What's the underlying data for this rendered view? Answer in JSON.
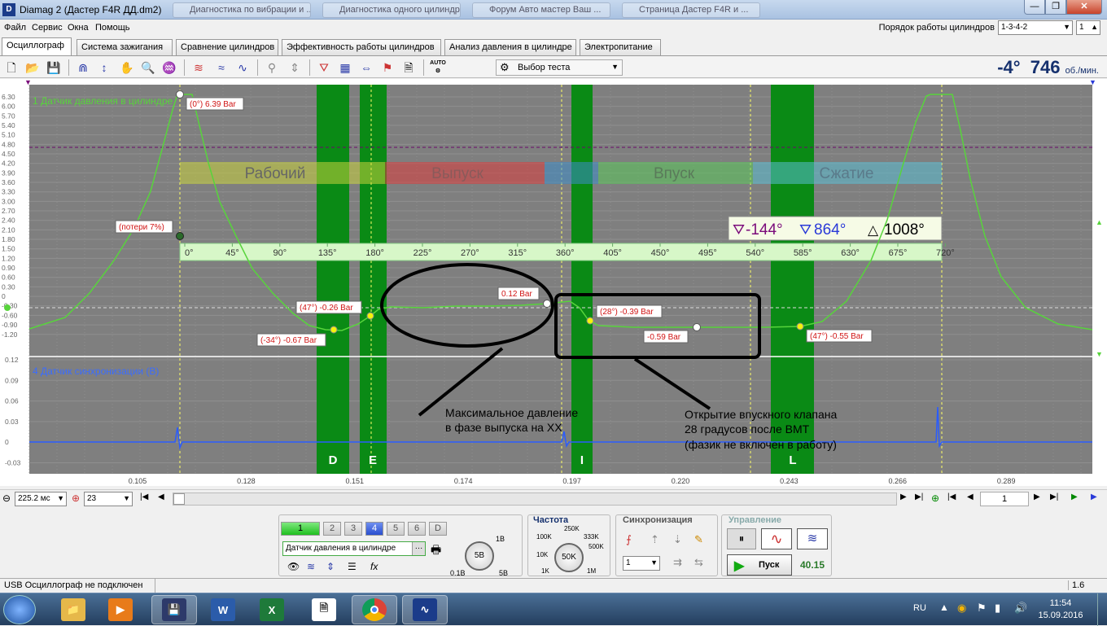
{
  "window": {
    "title": "Diamag 2 (Дастер F4R ДД.dm2)",
    "icon_label": "D",
    "bg_tabs": [
      "Диагностика по вибрации и ...",
      "Диагностика одного цилиндра",
      "Форум Авто мастер Ваш ...",
      "Страница Дастер F4R и ..."
    ]
  },
  "menu": {
    "items": [
      "Файл",
      "Сервис",
      "Окна",
      "Помощь"
    ]
  },
  "cyl_order": {
    "label": "Порядок работы цилиндров",
    "value": "1-3-4-2",
    "num": "1"
  },
  "tabs": [
    "Осциллограф",
    "Система зажигания",
    "Сравнение цилиндров",
    "Эффективность работы цилиндров",
    "Анализ давления в цилиндре",
    "Электропитание"
  ],
  "toolbar": {
    "test_select": "Выбор теста",
    "auto_label": "AUTO"
  },
  "rpm": {
    "angle": "-4°",
    "value": "746",
    "unit": "об./мин."
  },
  "scope": {
    "ch1_label": "1 Датчик давления в цилиндре",
    "ch4_label": "4 Датчик синхронизации (В)",
    "y_ticks_ch1": [
      "6.30",
      "6.00",
      "5.70",
      "5.40",
      "5.10",
      "4.80",
      "4.50",
      "4.20",
      "3.90",
      "3.60",
      "3.30",
      "3.00",
      "2.70",
      "2.40",
      "2.10",
      "1.80",
      "1.50",
      "1.20",
      "0.90",
      "0.60",
      "0.30",
      "0",
      "-0.30",
      "-0.60",
      "-0.90",
      "-1.20"
    ],
    "y_ticks_ch4": [
      "0.12",
      "0.09",
      "0.06",
      "0.03",
      "0",
      "-0.03"
    ],
    "x_ticks": [
      "0.105",
      "0.128",
      "0.151",
      "0.174",
      "0.197",
      "0.220",
      "0.243",
      "0.266",
      "0.289"
    ],
    "phases": [
      "Рабочий",
      "Выпуск",
      "Впуск",
      "Сжатие"
    ],
    "deg_ticks": [
      "0°",
      "45°",
      "90°",
      "135°",
      "180°",
      "225°",
      "270°",
      "315°",
      "360°",
      "405°",
      "450°",
      "495°",
      "540°",
      "585°",
      "630°",
      "675°",
      "720°"
    ],
    "markers": {
      "m1": "-144°",
      "m2": "864°",
      "delta": "1008°"
    },
    "valve_labels": [
      "D",
      "E",
      "I",
      "L"
    ],
    "annotations": {
      "a0": "(0°) 6.39 Bar",
      "loss": "(потери 7%)",
      "a47a": "(47°) -0.26 Bar",
      "a34": "(-34°) -0.67 Bar",
      "a012": "0.12 Bar",
      "a28": "(28°) -0.39 Bar",
      "a059": "-0.59 Bar",
      "a47b": "(47°) -0.55 Bar"
    },
    "note1_line1": "Максимальное давление",
    "note1_line2": "в фазе выпуска на ХХ",
    "note2_line1": "Открытие впускного клапана",
    "note2_line2": "28 градусов после ВМТ",
    "note2_line3": "(фазик не включен в работу)"
  },
  "bottombar": {
    "timebase": "225.2 мс",
    "trigger": "23",
    "frame": "1"
  },
  "channels": {
    "buttons": [
      "1",
      "2",
      "3",
      "4",
      "5",
      "6",
      "D"
    ],
    "sensor": "Датчик давления в цилиндре",
    "volt_value": "5В",
    "volt_labels": [
      "1В",
      "0.1В",
      "5В"
    ]
  },
  "frequency": {
    "title": "Частота",
    "value": "50K",
    "labels": [
      "250K",
      "100K",
      "333K",
      "500K",
      "10K",
      "1K",
      "1M"
    ]
  },
  "sync": {
    "title": "Синхронизация",
    "channel": "1"
  },
  "control": {
    "title": "Управление",
    "start_label": "Пуск",
    "time": "40.15"
  },
  "status": {
    "text": "USB Осциллограф не подключен",
    "version": "1.6"
  },
  "taskbar": {
    "lang": "RU",
    "time": "11:54",
    "date": "15.09.2016"
  },
  "colors": {
    "trace": "#58d43c",
    "sync_trace": "#2a5cff",
    "valve_band": "#0a8a15",
    "annot_text": "#d01414"
  }
}
